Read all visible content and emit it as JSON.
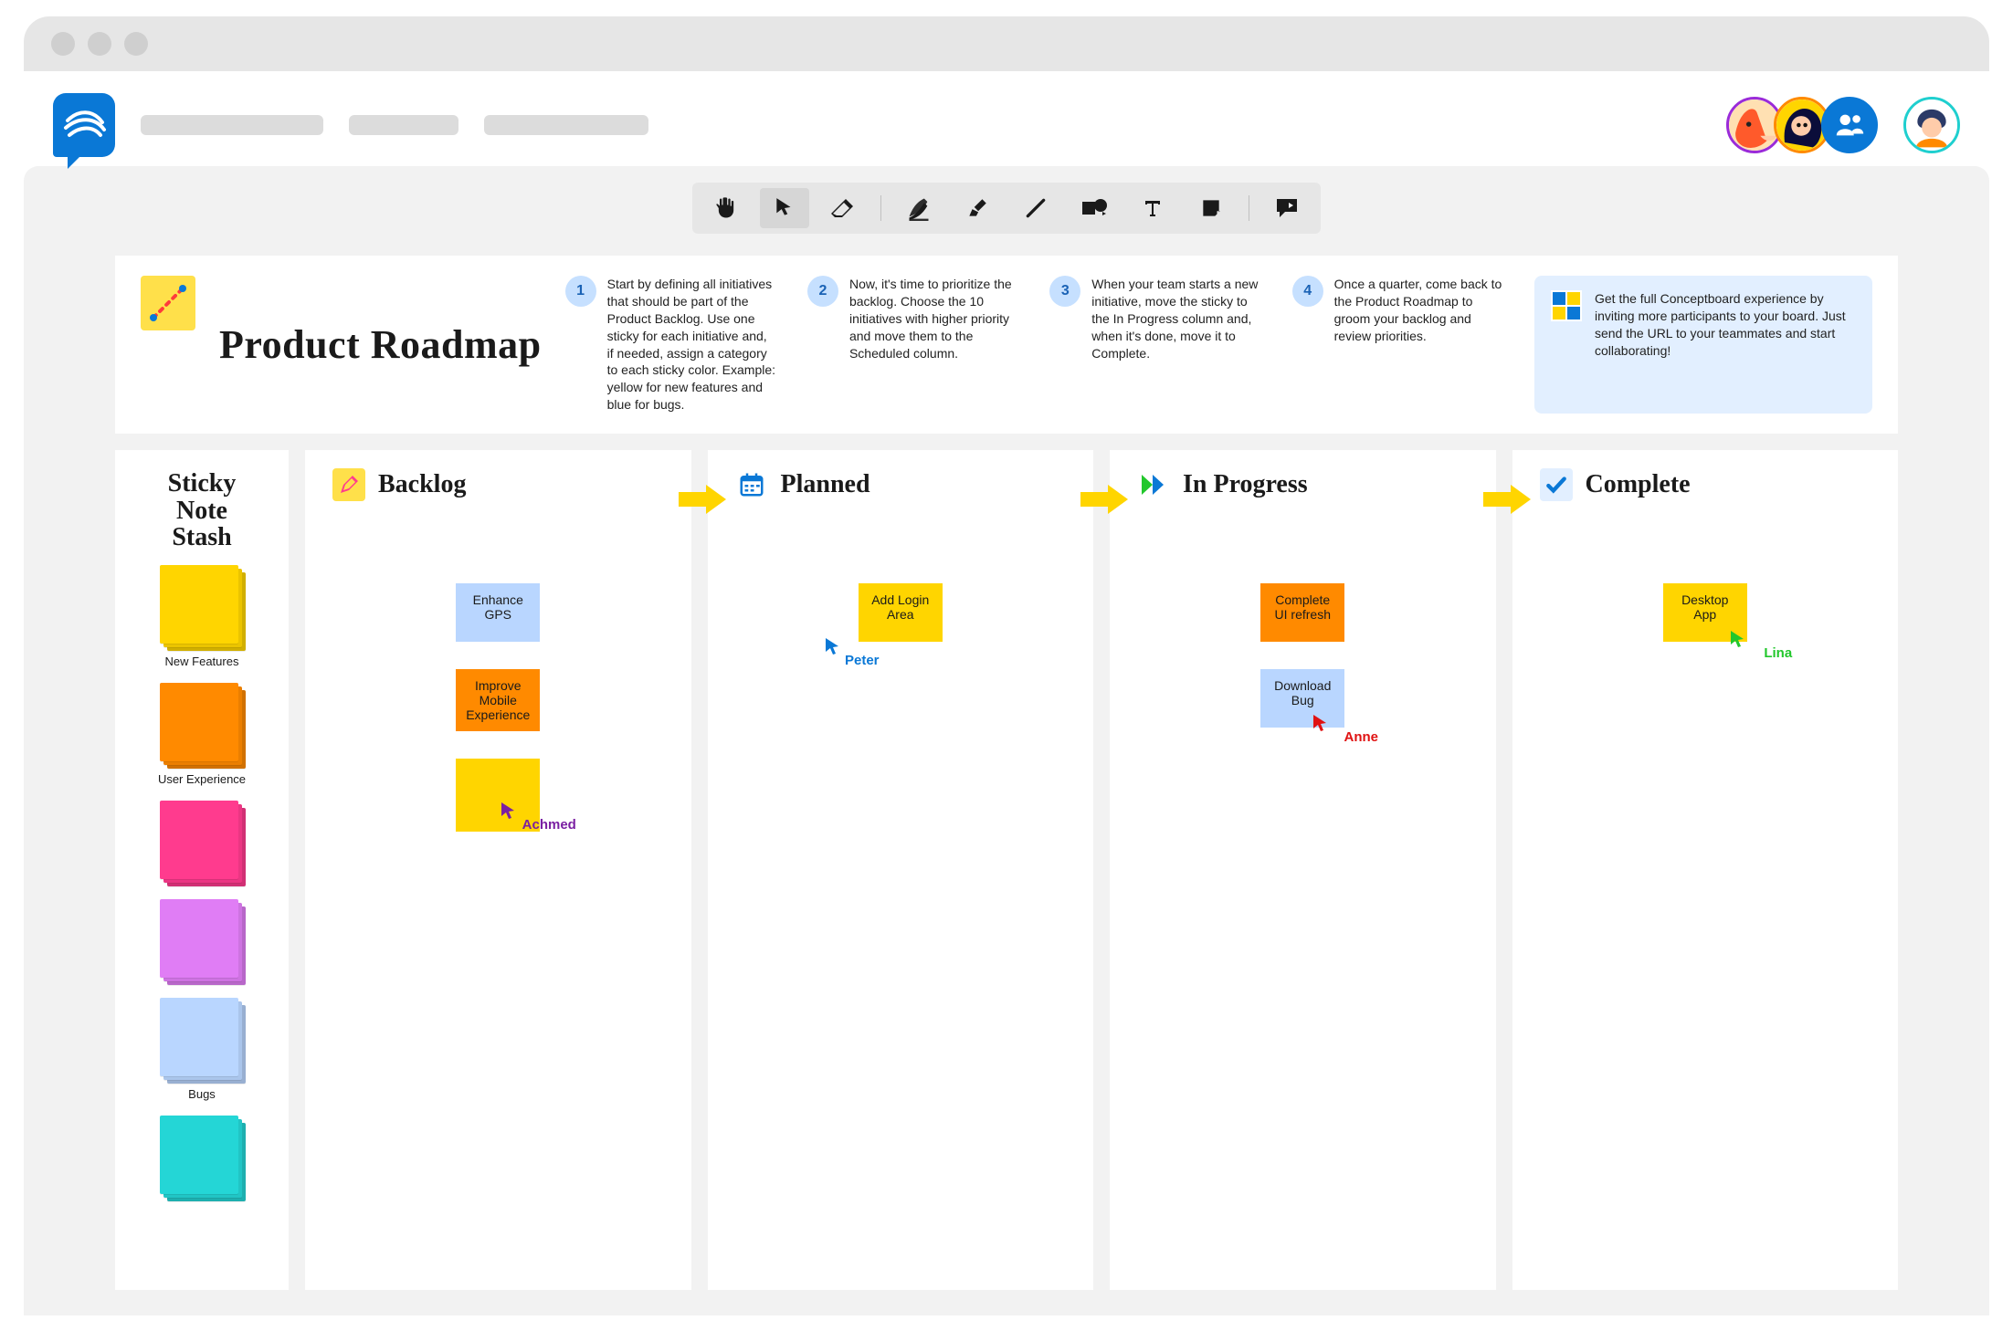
{
  "title": "Product Roadmap",
  "steps": [
    {
      "n": "1",
      "text": "Start by defining all initiatives that should be part of the Product Backlog. Use one sticky for each initiative and, if needed, assign a category to each sticky color. Example: yellow for new features and blue for bugs."
    },
    {
      "n": "2",
      "text": "Now, it's time to prioritize the backlog. Choose the 10 initiatives with higher priority and move them to the Scheduled column."
    },
    {
      "n": "3",
      "text": "When your team starts a new initiative, move the sticky to the In Progress column and, when it's done, move it to Complete."
    },
    {
      "n": "4",
      "text": "Once a quarter, come back to the Product Roadmap to groom your backlog and review priorities."
    }
  ],
  "promo": "Get the full Conceptboard experience by inviting more participants to your board. Just send the URL to your teammates and start collaborating!",
  "stash": {
    "title_l1": "Sticky",
    "title_l2": "Note",
    "title_l3": "Stash",
    "items": [
      {
        "label": "New Features",
        "color": "#ffd500"
      },
      {
        "label": "User Experience",
        "color": "#ff8a00"
      },
      {
        "label": "",
        "color": "#ff3b8e"
      },
      {
        "label": "",
        "color": "#e07df5"
      },
      {
        "label": "Bugs",
        "color": "#b9d6ff"
      },
      {
        "label": "",
        "color": "#24d6d6"
      }
    ]
  },
  "columns": {
    "backlog": {
      "title": "Backlog",
      "notes": [
        {
          "text": "Enhance GPS",
          "color": "#b9d6ff"
        },
        {
          "text": "Improve Mobile Experience",
          "color": "#ff8a00"
        },
        {
          "text": "",
          "color": "#ffd500",
          "blank": true
        }
      ]
    },
    "planned": {
      "title": "Planned",
      "notes": [
        {
          "text": "Add Login Area",
          "color": "#ffd500"
        }
      ]
    },
    "progress": {
      "title": "In Progress",
      "notes": [
        {
          "text": "Complete UI refresh",
          "color": "#ff8a00"
        },
        {
          "text": "Download Bug",
          "color": "#b9d6ff"
        }
      ]
    },
    "complete": {
      "title": "Complete",
      "notes": [
        {
          "text": "Desktop App",
          "color": "#ffd500"
        }
      ]
    }
  },
  "cursors": {
    "achmed": {
      "name": "Achmed",
      "color": "#7a1fa2"
    },
    "peter": {
      "name": "Peter",
      "color": "#0a78d6"
    },
    "anne": {
      "name": "Anne",
      "color": "#e01212"
    },
    "lina": {
      "name": "Lina",
      "color": "#22c72c"
    }
  },
  "avatars": {
    "a1": {
      "ring": "#9a2bd9"
    },
    "a2": {
      "ring": "#ff8a00"
    },
    "group": {},
    "profile": {
      "ring": "#1fcfcf"
    }
  }
}
